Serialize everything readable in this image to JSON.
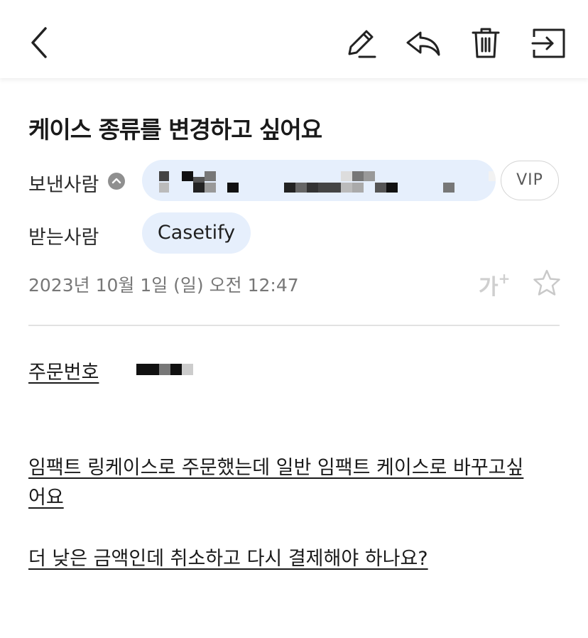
{
  "toolbar": {
    "back_icon": "chevron-left-icon",
    "edit_icon": "pencil-icon",
    "reply_icon": "reply-icon",
    "delete_icon": "trash-icon",
    "move_icon": "move-to-folder-icon"
  },
  "email": {
    "subject": "케이스 종류를 변경하고 싶어요",
    "sender_label": "보낸사람",
    "vip_label": "VIP",
    "recipient_label": "받는사람",
    "recipient": "Casetify",
    "date": "2023년 10월 1일 (일) 오전 12:47",
    "font_size_label": "가",
    "font_size_plus": "+"
  },
  "body": {
    "order_label": "주문번호",
    "line1": "임팩트 링케이스로 주문했는데 일반 임팩트 케이스로 바꾸고싶",
    "line2": "어요",
    "line3": "더 낮은 금액인데 취소하고 다시 결제해야 하나요?"
  },
  "colors": {
    "pill_background": "#e6effc",
    "text_primary": "#1a1a1a",
    "text_secondary": "#777777",
    "divider": "#e2e2e2"
  }
}
